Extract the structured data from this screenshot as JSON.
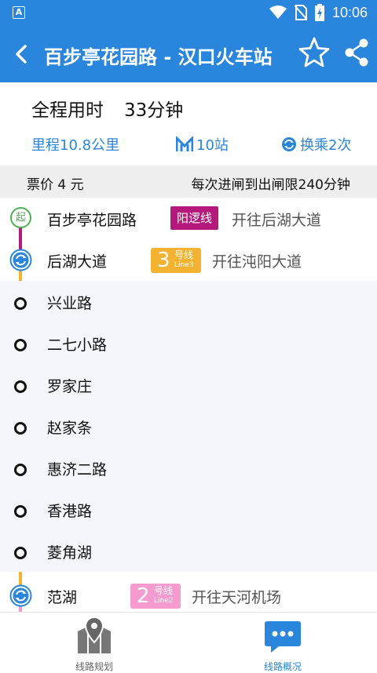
{
  "status_bar": {
    "app_icon": "A",
    "time": "10:06",
    "icons": [
      "wifi-icon",
      "no-sim-icon",
      "battery-charging-icon"
    ]
  },
  "app_bar": {
    "title": "百步亭花园路 - 汉口火车站",
    "icons": [
      "back-arrow-icon",
      "star-outline-icon",
      "share-icon"
    ]
  },
  "summary": {
    "total_label": "全程用时",
    "total_value": "33分钟",
    "distance": "里程10.8公里",
    "stations": "10站",
    "transfers": "换乘2次",
    "accent_color": "#2a86dc"
  },
  "fare": {
    "price": "票价 4 元",
    "limit": "每次进闸到出闸限240分钟"
  },
  "route": {
    "start": {
      "icon_text": "起",
      "name": "百步亭花园路",
      "line_badge": "阳逻线",
      "line_color": "#b5197c",
      "direction": "开往后湖大道"
    },
    "transfer_1": {
      "name": "后湖大道",
      "line_number": "3",
      "line_label": "号线",
      "line_en": "Line3",
      "line_color": "#f3b22f",
      "direction": "开往沌阳大道"
    },
    "stops": [
      "兴业路",
      "二七小路",
      "罗家庄",
      "赵家条",
      "惠济二路",
      "香港路",
      "菱角湖"
    ],
    "transfer_2": {
      "name": "范湖",
      "line_number": "2",
      "line_label": "号线",
      "line_en": "Line2",
      "line_color": "#f59bd0",
      "direction": "开往天河机场"
    }
  },
  "bottom_nav": {
    "items": [
      {
        "label": "线路规划",
        "icon": "map-pin-icon",
        "active": false
      },
      {
        "label": "线路概况",
        "icon": "chat-bubble-icon",
        "active": true
      }
    ]
  }
}
